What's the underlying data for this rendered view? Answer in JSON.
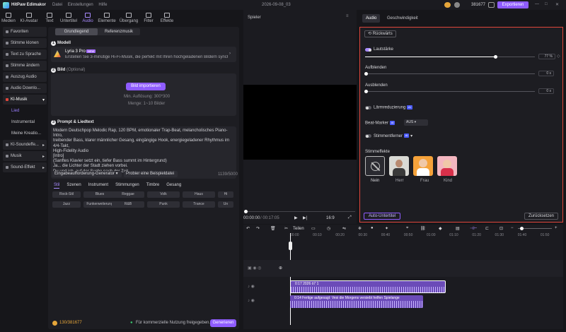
{
  "app": {
    "name": "HitPaw Edimakor",
    "menu": [
      "Datei",
      "Einstellungen",
      "Hilfe"
    ],
    "doc_title": "2026-09-08_03",
    "credits": "381677",
    "export_label": "Exportieren"
  },
  "toolbar": [
    {
      "label": "Medien",
      "icon": "media-icon"
    },
    {
      "label": "KI-Avatar",
      "icon": "avatar-icon"
    },
    {
      "label": "Text",
      "icon": "text-icon"
    },
    {
      "label": "Untertitel",
      "icon": "subtitle-icon"
    },
    {
      "label": "Audio",
      "icon": "audio-icon",
      "active": true
    },
    {
      "label": "Elemente",
      "icon": "elements-icon"
    },
    {
      "label": "Übergang",
      "icon": "transition-icon"
    },
    {
      "label": "Filter",
      "icon": "filter-icon"
    },
    {
      "label": "Effekte",
      "icon": "effects-icon"
    }
  ],
  "sidebar": [
    {
      "label": "Favoriten"
    },
    {
      "label": "Stimme klonen"
    },
    {
      "label": "Text zu Sprache"
    },
    {
      "label": "Stimme ändern"
    },
    {
      "label": "Auszug Audio"
    },
    {
      "label": "Audio Downlo..."
    },
    {
      "label": "KI-Musik"
    },
    {
      "label": "Lied",
      "sub": true,
      "active": true
    },
    {
      "label": "Instrumental",
      "sub": true
    },
    {
      "label": "Meine Kreatio...",
      "sub": true
    },
    {
      "label": "KI-Soundeffe..."
    },
    {
      "label": "Musik"
    },
    {
      "label": "Sound-Effekt"
    }
  ],
  "left_tabs": [
    "Grundlegend",
    "Referenzmusik"
  ],
  "model": {
    "heading": "Modell",
    "name": "Lyria 3 Pro",
    "badge": "NEW",
    "desc": "Erstellen Sie 3-minütige Hi-Fi-Musik, die perfekt mit Ihren hochgeladenen Bildern synchr..."
  },
  "image": {
    "heading": "Bild",
    "optional": "(Optional)",
    "button": "Bild importieren",
    "min_res": "Min. Auflösung: 300*300",
    "count": "Menge: 1~10 Bilder"
  },
  "prompt": {
    "heading": "Prompt & Liedtext",
    "lines": [
      "Modern Deutschpop Melodic Rap, 120 BPM, emotionaler Trap-Beat, melancholisches Piano-Intro,",
      "treibender Bass, klarer männlicher Gesang, eingängige Hook, energiegeladener Rhythmus im 4/4-Takt,",
      "High-Fidelity Audio",
      "",
      "[Intro]",
      "(Sanftes Klavier setzt ein, tiefer Bass summt im Hintergrund)",
      "Ja... die Lichter der Stadt ziehen vorbei.",
      "Du und ich, auf der Suche nach der Zeit."
    ],
    "gen_btn": "Eingabeaufforderung-Generator",
    "example_btn": "Probier eine Beispieldatei",
    "counter": "1139/5000"
  },
  "style_tabs": [
    "Stil",
    "Szenen",
    "Instrument",
    "Stimmungen",
    "Timbre",
    "Gesang"
  ],
  "styles_row1": [
    "Rock-Stil",
    "Blues",
    "Reggae",
    "Volk",
    "Haus",
    "Hi"
  ],
  "styles_row2": [
    "Jazz",
    "Funkerweiterung",
    "R&B",
    "Punk",
    "Trance",
    "Un"
  ],
  "footer": {
    "credits": "130/381677",
    "note": "Für kommerzielle Nutzung freigegeben.",
    "generate": "Generieren"
  },
  "player": {
    "title": "Spieler",
    "time_current": "00:00:00",
    "time_total": "/ 00:17:05",
    "ratio": "16:9"
  },
  "right": {
    "tabs": [
      "Audio",
      "Geschwindigkeit"
    ],
    "reset_top": "Rückwärts",
    "volume": {
      "label": "Lautstärke",
      "value": "77 %",
      "level": 0.77
    },
    "fade_in": {
      "label": "Aufblenden",
      "value": "0 s"
    },
    "fade_out": {
      "label": "Ausblenden",
      "value": "0 s"
    },
    "denoise": {
      "label": "Lärmreduzierung",
      "ai": "AI"
    },
    "beat": {
      "label": "Beat-Marker",
      "ai": "AI",
      "value": "AUS"
    },
    "vocal": {
      "label": "Stimmentferner",
      "ai": "AI"
    },
    "voice_fx": {
      "label": "Stimmeffekte",
      "items": [
        "Nein",
        "Herr",
        "Frau",
        "Kind"
      ]
    },
    "subtitle_btn": "Auto-Untertitel",
    "reset_btn": "Zurücksetzen"
  },
  "timeline": {
    "split": "Teilen",
    "ruler": [
      "00:00",
      "00:10",
      "00:20",
      "00:30",
      "00:40",
      "00:50",
      "01:00",
      "01:10",
      "01:20",
      "01:30",
      "01:40",
      "01:50"
    ],
    "clip1": "0:17 2026 ö7 1",
    "clip2": "0:14 Fertige aufgesagt: Vesi die Morgens versiebt helfen Spielange"
  },
  "colors": {
    "accent": "#8f5cff",
    "highlight": "#e0463b",
    "clip": "#8a5cd8"
  }
}
